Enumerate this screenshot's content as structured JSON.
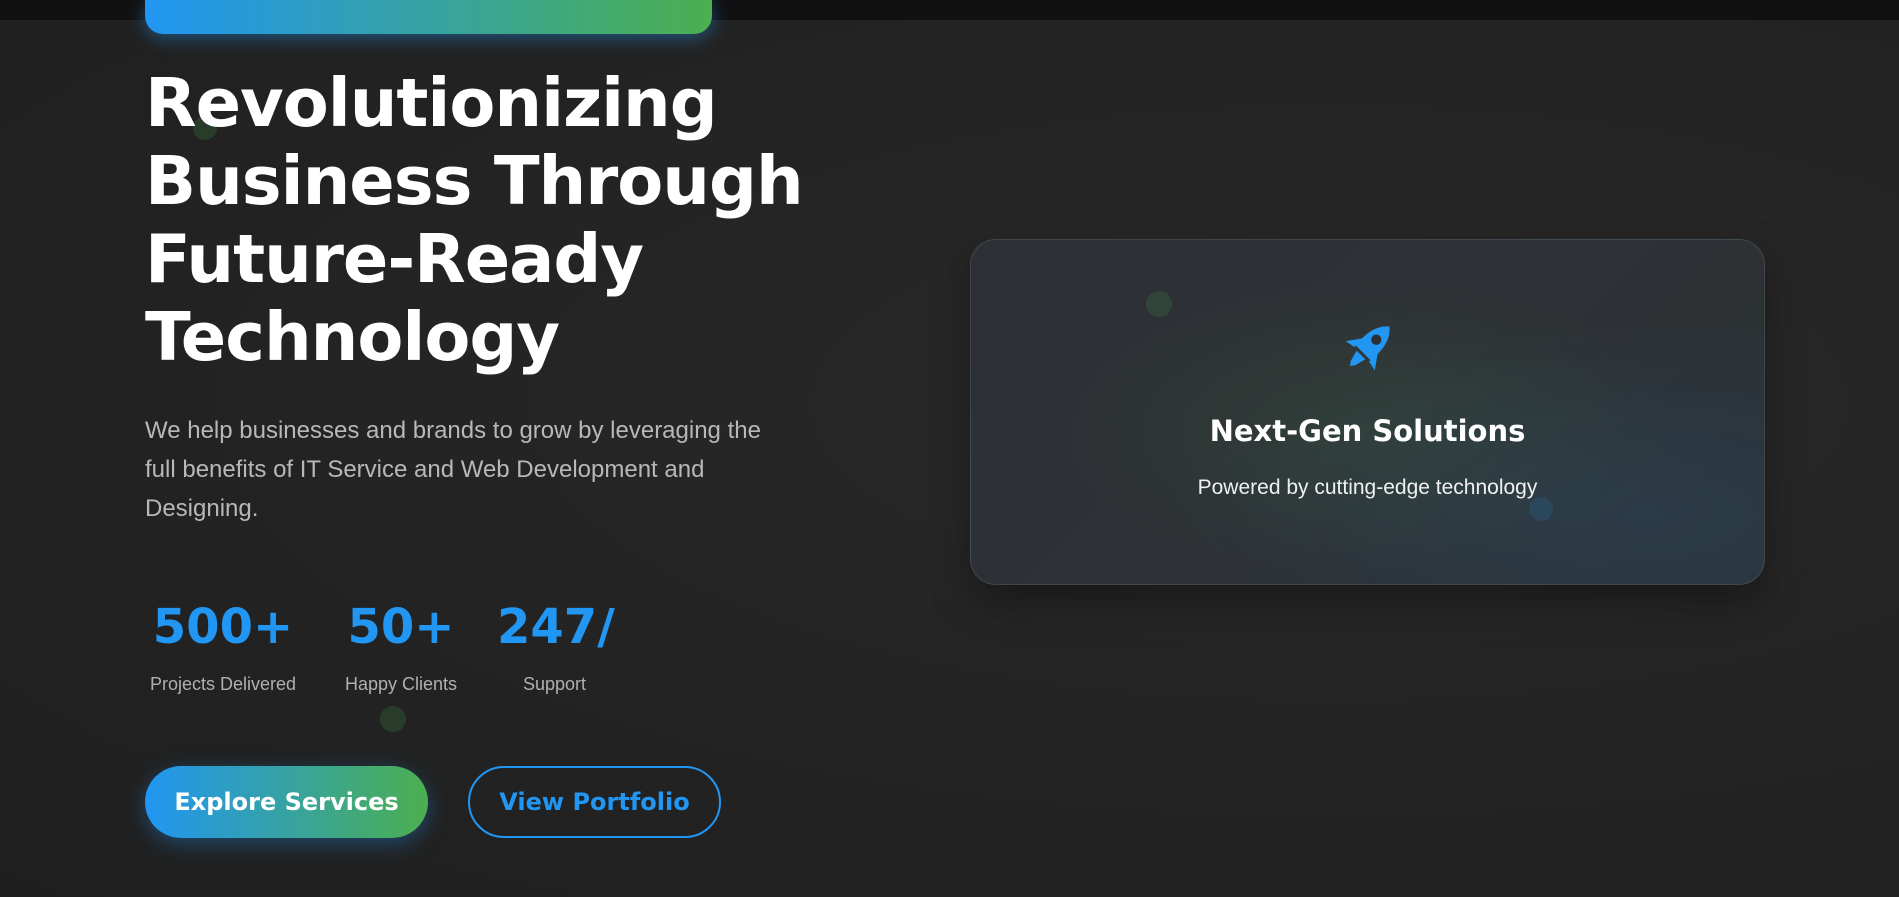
{
  "hero": {
    "title_lines": [
      "Revolutionizing",
      "Business Through",
      "Future-Ready",
      "Technology"
    ],
    "description": "We help businesses and brands to grow by leveraging the full benefits of IT Service and Web Development and Designing."
  },
  "stats": [
    {
      "value": "500+",
      "label": "Projects Delivered"
    },
    {
      "value": "50+",
      "label": "Happy Clients"
    },
    {
      "value": "247/",
      "label": "Support"
    }
  ],
  "buttons": {
    "primary_label": "Explore Services",
    "secondary_label": "View Portfolio"
  },
  "card": {
    "icon": "rocket-icon",
    "title": "Next-Gen Solutions",
    "subtitle": "Powered by cutting-edge technology"
  },
  "colors": {
    "accent_blue": "#2196F3",
    "accent_green": "#4CAF50",
    "background": "#222222"
  }
}
